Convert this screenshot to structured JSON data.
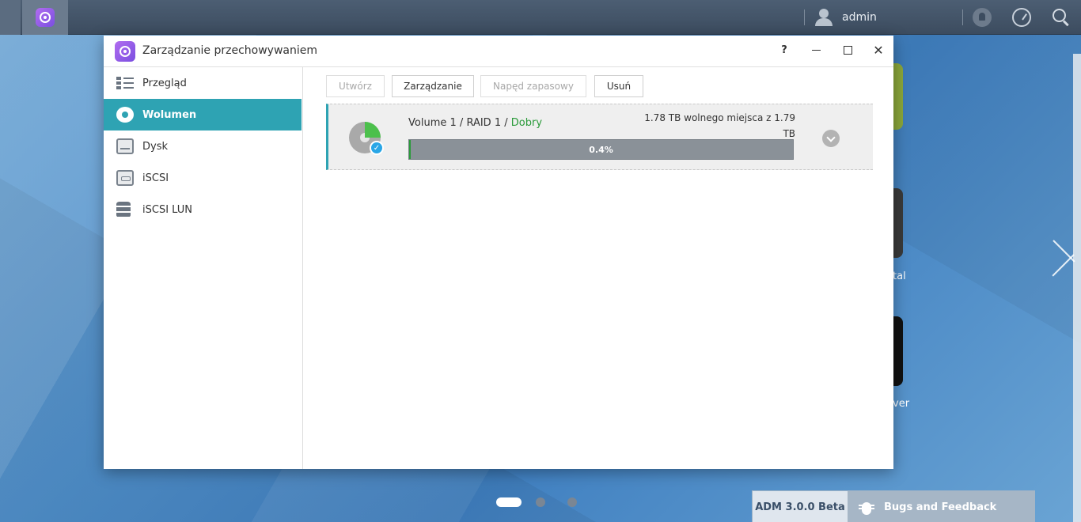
{
  "taskbar": {
    "user_name": "admin"
  },
  "window": {
    "title": "Zarządzanie przechowywaniem",
    "help_glyph": "?",
    "close_glyph": "✕"
  },
  "sidebar": {
    "items": [
      {
        "label": "Przegląd",
        "icon": "list-icon"
      },
      {
        "label": "Wolumen",
        "icon": "volume-icon",
        "active": true
      },
      {
        "label": "Dysk",
        "icon": "disk-icon"
      },
      {
        "label": "iSCSI",
        "icon": "iscsi-icon"
      },
      {
        "label": "iSCSI LUN",
        "icon": "database-icon"
      }
    ]
  },
  "toolbar": {
    "create_label": "Utwórz",
    "manage_label": "Zarządzanie",
    "spare_label": "Napęd zapasowy",
    "delete_label": "Usuń"
  },
  "volume": {
    "name": "Volume 1",
    "raid": "RAID 1",
    "status": "Dobry",
    "separator": "/",
    "free_space": "1.78 TB wolnego miejsca z 1.79 TB",
    "usage_percent": 0.4,
    "usage_label": "0.4%",
    "check_glyph": "✓"
  },
  "desktop": {
    "partial_labels": [
      "tal",
      "ver"
    ],
    "page_count": 3,
    "active_page": 1
  },
  "footer": {
    "version": "ADM 3.0.0 Beta",
    "feedback_label": "Bugs and Feedback"
  },
  "colors": {
    "accent": "#2ea3b3",
    "status_good": "#2a9a3a",
    "progress_track": "#8a9198"
  }
}
